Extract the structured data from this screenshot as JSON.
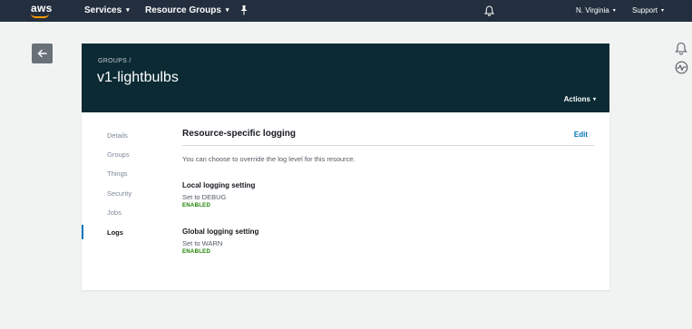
{
  "topnav": {
    "logo_text": "aws",
    "services_label": "Services",
    "resource_groups_label": "Resource Groups",
    "region_label": "N. Virginia",
    "support_label": "Support",
    "caret": "▾"
  },
  "header": {
    "breadcrumb": "GROUPS /",
    "title": "v1-lightbulbs",
    "actions_label": "Actions"
  },
  "sidebar": {
    "items": [
      {
        "label": "Details"
      },
      {
        "label": "Groups"
      },
      {
        "label": "Things"
      },
      {
        "label": "Security"
      },
      {
        "label": "Jobs"
      },
      {
        "label": "Logs"
      }
    ]
  },
  "content": {
    "section_title": "Resource-specific logging",
    "edit_label": "Edit",
    "description": "You can choose to override the log level for this resource.",
    "local": {
      "label": "Local logging setting",
      "value": "Set to DEBUG",
      "status": "ENABLED"
    },
    "global": {
      "label": "Global logging setting",
      "value": "Set to WARN",
      "status": "ENABLED"
    }
  },
  "colors": {
    "nav_bg": "#232f3e",
    "header_bg": "#0b2a34",
    "accent": "#0073bb",
    "enabled": "#1d8102",
    "logo_smile": "#ff9900"
  },
  "icons": [
    "aws-logo",
    "pin-icon",
    "bell-icon",
    "back-arrow-icon",
    "notification-bell-icon",
    "health-icon"
  ]
}
